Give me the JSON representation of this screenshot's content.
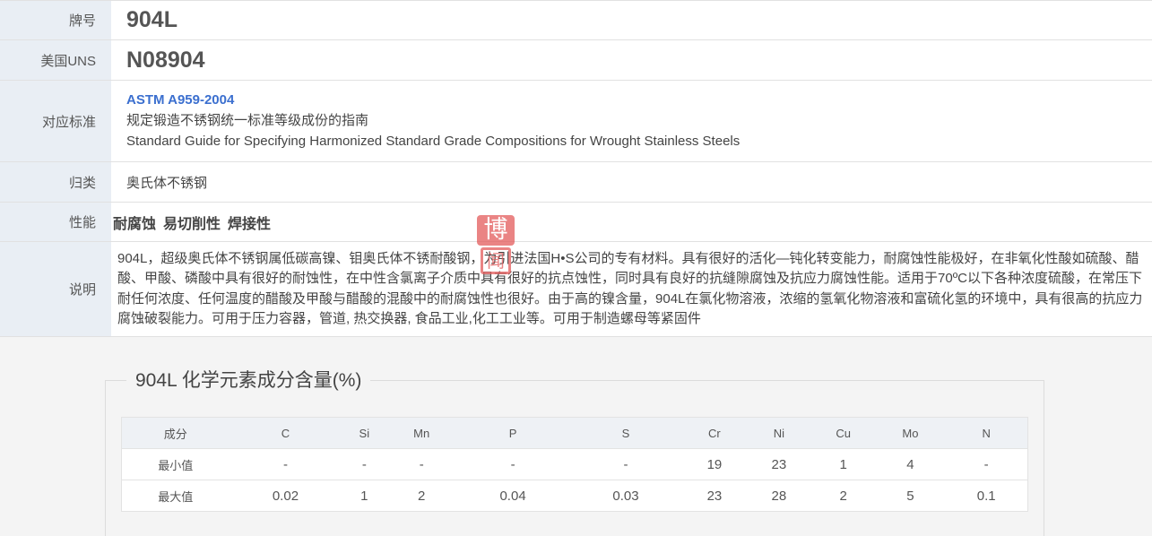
{
  "info": {
    "grade": {
      "label": "牌号",
      "value": "904L"
    },
    "uns": {
      "label": "美国UNS",
      "value": "N08904"
    },
    "standard": {
      "label": "对应标准",
      "code": "ASTM A959-2004",
      "title_cn": "规定锻造不锈钢统一标准等级成份的指南",
      "title_en": "Standard Guide for Specifying Harmonized Standard Grade Compositions for Wrought Stainless Steels"
    },
    "category": {
      "label": "归类",
      "value": "奥氏体不锈钢"
    },
    "properties": {
      "label": "性能",
      "items": [
        "耐腐蚀",
        "易切削性",
        "焊接性"
      ]
    },
    "description": {
      "label": "说明",
      "text": "904L，超级奥氏体不锈钢属低碳高镍、钼奥氏体不锈耐酸钢，为引进法国H•S公司的专有材料。具有很好的活化—钝化转变能力，耐腐蚀性能极好，在非氧化性酸如硫酸、醋酸、甲酸、磷酸中具有很好的耐蚀性，在中性含氯离子介质中具有很好的抗点蚀性，同时具有良好的抗缝隙腐蚀及抗应力腐蚀性能。适用于70ºC以下各种浓度硫酸，在常压下耐任何浓度、任何温度的醋酸及甲酸与醋酸的混酸中的耐腐蚀性也很好。由于高的镍含量，904L在氯化物溶液，浓缩的氢氧化物溶液和富硫化氢的环境中，具有很高的抗应力腐蚀破裂能力。可用于压力容器，管道, 热交换器, 食品工业,化工工业等。可用于制造螺母等紧固件"
    }
  },
  "seal": {
    "char1": "博",
    "char2": "闻"
  },
  "chemistry": {
    "title": "904L 化学元素成分含量(%)",
    "header_label": "成分",
    "elements": [
      "C",
      "Si",
      "Mn",
      "P",
      "S",
      "Cr",
      "Ni",
      "Cu",
      "Mo",
      "N"
    ],
    "rows": [
      {
        "label": "最小值",
        "values": [
          "-",
          "-",
          "-",
          "-",
          "-",
          "19",
          "23",
          "1",
          "4",
          "-"
        ]
      },
      {
        "label": "最大值",
        "values": [
          "0.02",
          "1",
          "2",
          "0.04",
          "0.03",
          "23",
          "28",
          "2",
          "5",
          "0.1"
        ]
      }
    ]
  }
}
